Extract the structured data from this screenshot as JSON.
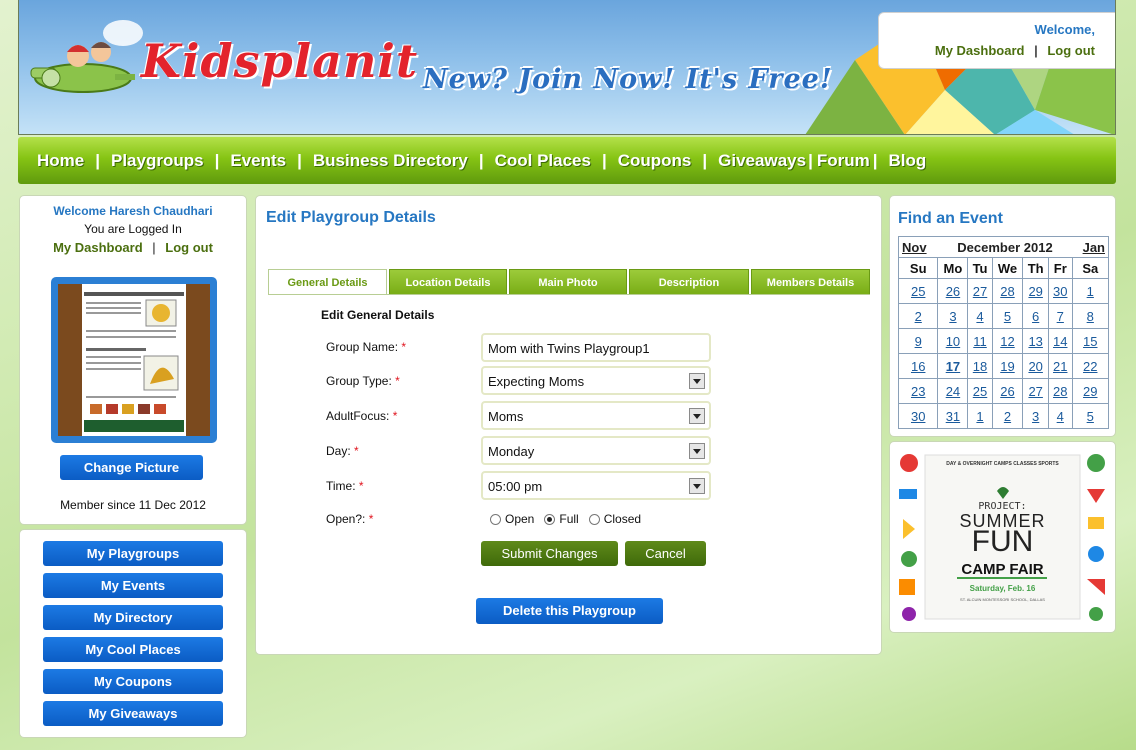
{
  "header": {
    "logo": "Kidsplanit",
    "tagline": "New? Join Now! It's Free!",
    "welcome": "Welcome,",
    "dashboard_link": "My Dashboard",
    "separator": "|",
    "logout_link": "Log out"
  },
  "nav": {
    "items": [
      "Home",
      "Playgroups",
      "Events",
      "Business Directory",
      "Cool Places",
      "Coupons",
      "Giveaways",
      "Forum",
      "Blog"
    ]
  },
  "sidebar": {
    "welcome_name": "Welcome Haresh Chaudhari",
    "logged_in": "You are Logged In",
    "dashboard_link": "My Dashboard",
    "separator": "|",
    "logout_link": "Log out",
    "change_picture": "Change Picture",
    "member_since": "Member since 11 Dec 2012",
    "buttons": [
      "My Playgroups",
      "My Events",
      "My Directory",
      "My Cool Places",
      "My Coupons",
      "My Giveaways"
    ]
  },
  "main": {
    "title": "Edit Playgroup Details",
    "tabs": [
      "General Details",
      "Location Details",
      "Main Photo",
      "Description",
      "Members Details"
    ],
    "form_title": "Edit General Details",
    "fields": {
      "group_name": {
        "label": "Group Name:",
        "value": "Mom with Twins Playgroup1"
      },
      "group_type": {
        "label": "Group Type:",
        "value": "Expecting Moms"
      },
      "adult_focus": {
        "label": "AdultFocus:",
        "value": "Moms"
      },
      "day": {
        "label": "Day:",
        "value": "Monday"
      },
      "time": {
        "label": "Time:",
        "value": "05:00 pm"
      },
      "open": {
        "label": "Open?:",
        "options": [
          "Open",
          "Full",
          "Closed"
        ],
        "selected": "Full"
      }
    },
    "required_mark": "*",
    "submit": "Submit Changes",
    "cancel": "Cancel",
    "delete": "Delete this Playgroup"
  },
  "calendar": {
    "title": "Find an Event",
    "prev": "Nov",
    "month": "December 2012",
    "next": "Jan",
    "weekdays": [
      "Su",
      "Mo",
      "Tu",
      "We",
      "Th",
      "Fr",
      "Sa"
    ],
    "weeks": [
      [
        "25",
        "26",
        "27",
        "28",
        "29",
        "30",
        "1"
      ],
      [
        "2",
        "3",
        "4",
        "5",
        "6",
        "7",
        "8"
      ],
      [
        "9",
        "10",
        "11",
        "12",
        "13",
        "14",
        "15"
      ],
      [
        "16",
        "17",
        "18",
        "19",
        "20",
        "21",
        "22"
      ],
      [
        "23",
        "24",
        "25",
        "26",
        "27",
        "28",
        "29"
      ],
      [
        "30",
        "31",
        "1",
        "2",
        "3",
        "4",
        "5"
      ]
    ],
    "today": "17"
  },
  "ad": {
    "top_text": "DAY & OVERNIGHT CAMPS  CLASSES  SPORTS",
    "project": "PROJECT:",
    "summer": "SUMMER",
    "fun": "FUN",
    "camp_fair": "CAMP FAIR",
    "date": "Saturday, Feb. 16",
    "venue": "ST. ALCUIN MONTESSORI SCHOOL, DALLAS"
  },
  "colors": {
    "accent_blue": "#2677c2",
    "nav_green": "#86c414",
    "button_blue": "#0b5cc4",
    "button_green": "#4b7a12",
    "required": "#e0141e"
  }
}
